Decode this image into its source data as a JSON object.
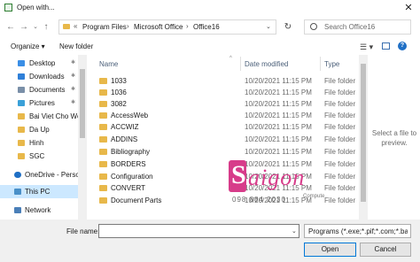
{
  "window": {
    "title": "Open with...",
    "close_glyph": "✕"
  },
  "nav": {
    "back_icon": "arrow-left-icon",
    "forward_icon": "arrow-right-icon",
    "recent_icon": "chevron-down-icon",
    "up_icon": "arrow-up-icon",
    "breadcrumb": [
      "Program Files",
      "Microsoft Office",
      "Office16"
    ],
    "breadcrumb_sep": "›",
    "overflow": "«",
    "search_placeholder": "Search Office16"
  },
  "toolbar": {
    "organize_label": "Organize ▾",
    "new_folder_label": "New folder"
  },
  "sidebar": {
    "items": [
      {
        "label": "Desktop",
        "icon": "desktop-icon",
        "pinned": true
      },
      {
        "label": "Downloads",
        "icon": "download-icon",
        "pinned": true
      },
      {
        "label": "Documents",
        "icon": "documents-icon",
        "pinned": true
      },
      {
        "label": "Pictures",
        "icon": "pictures-icon",
        "pinned": true
      },
      {
        "label": "Bai Viet Cho Web",
        "icon": "folder-icon",
        "pinned": false
      },
      {
        "label": "Da Up",
        "icon": "folder-icon",
        "pinned": false
      },
      {
        "label": "Hinh",
        "icon": "folder-icon",
        "pinned": false
      },
      {
        "label": "SGC",
        "icon": "folder-icon",
        "pinned": false
      },
      {
        "label": "OneDrive - Person",
        "icon": "cloud-icon",
        "pinned": false
      },
      {
        "label": "This PC",
        "icon": "computer-icon",
        "pinned": false,
        "selected": true
      },
      {
        "label": "Network",
        "icon": "network-icon",
        "pinned": false
      }
    ]
  },
  "columns": {
    "name": "Name",
    "date": "Date modified",
    "type": "Type"
  },
  "files": [
    {
      "name": "1033",
      "date": "10/20/2021 11:15 PM",
      "type": "File folder"
    },
    {
      "name": "1036",
      "date": "10/20/2021 11:15 PM",
      "type": "File folder"
    },
    {
      "name": "3082",
      "date": "10/20/2021 11:15 PM",
      "type": "File folder"
    },
    {
      "name": "AccessWeb",
      "date": "10/20/2021 11:15 PM",
      "type": "File folder"
    },
    {
      "name": "ACCWIZ",
      "date": "10/20/2021 11:15 PM",
      "type": "File folder"
    },
    {
      "name": "ADDINS",
      "date": "10/20/2021 11:15 PM",
      "type": "File folder"
    },
    {
      "name": "Bibliography",
      "date": "10/20/2021 11:15 PM",
      "type": "File folder"
    },
    {
      "name": "BORDERS",
      "date": "10/20/2021 11:15 PM",
      "type": "File folder"
    },
    {
      "name": "Configuration",
      "date": "10/20/2021 11:15 PM",
      "type": "File folder"
    },
    {
      "name": "CONVERT",
      "date": "10/20/2021 11:15 PM",
      "type": "File folder"
    },
    {
      "name": "Document Parts",
      "date": "10/20/2021 11:15 PM",
      "type": "File folder"
    }
  ],
  "preview": {
    "text": "Select a file to preview."
  },
  "footer": {
    "file_name_label": "File name:",
    "file_name_value": "",
    "file_type_value": "Programs (*.exe;*.pif;*.com;*.bat",
    "open_label": "Open",
    "cancel_label": "Cancel"
  },
  "watermark": {
    "brand": "Saigon",
    "brand_first": "S",
    "brand_rest": "aigon",
    "sub": "Compute",
    "phone": "098 884 2030"
  },
  "colors": {
    "accent": "#0078d7",
    "folder": "#e8b84a",
    "watermark": "#d73c8a",
    "selected": "#cce8ff"
  }
}
